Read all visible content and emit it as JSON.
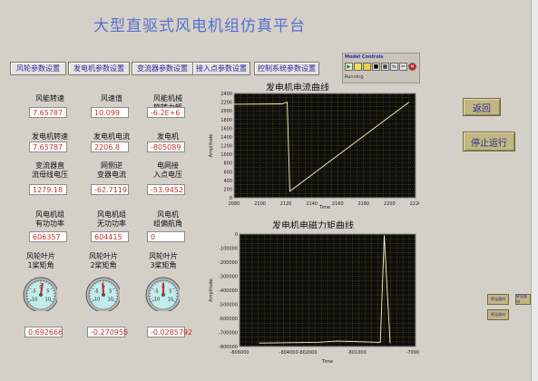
{
  "title": "大型直驱式风电机组仿真平台",
  "nav": [
    "风轮参数设置",
    "发电机参数设置",
    "变流器参数设置",
    "接入点参数设置",
    "控制系统参数设置"
  ],
  "fields": [
    {
      "label": "风能转速",
      "value": "7.65787"
    },
    {
      "label": "风速值",
      "value": "10.099"
    },
    {
      "label": "风能机械\n旋转力矩",
      "value": "-6.2E+6"
    },
    {
      "label": "发电机转速",
      "value": "7.65787"
    },
    {
      "label": "发电机电流",
      "value": "2206.8"
    },
    {
      "label": "发电机\n电磁力矩",
      "value": "-805089"
    },
    {
      "label": "变流器直\n流母线电压",
      "value": "1279.18"
    },
    {
      "label": "网侧逆\n变器电流",
      "value": "-62.7119"
    },
    {
      "label": "电网接\n入点电压",
      "value": "-53.9452"
    },
    {
      "label": "风电机组\n有功功率",
      "value": "606357"
    },
    {
      "label": "风电机组\n无功功率",
      "value": "604415"
    },
    {
      "label": "风电机\n组偏航角",
      "value": "0"
    }
  ],
  "blades": [
    {
      "label": "风轮叶片\n1桨矩角",
      "value": "0.692666",
      "gauge_value": 0.69
    },
    {
      "label": "风轮叶片\n2桨矩角",
      "value": "-0.270956",
      "gauge_value": -0.27
    },
    {
      "label": "风轮叶片\n3桨矩角",
      "value": "-0.0285792",
      "gauge_value": -0.03
    }
  ],
  "gauge_ticks": [
    "-5",
    "0",
    "5",
    "-10",
    "10"
  ],
  "model_controls": {
    "title": "Model Controls",
    "status": "Running"
  },
  "side_buttons": {
    "back": "返回",
    "stop": "停止运行"
  },
  "small_buttons": [
    "辉宝器材",
    "辉宝器材",
    "辉宝器材"
  ],
  "colors": {
    "plot_bg": "#0e0e0e",
    "grid": "#c8d000",
    "trace": "#fff6c0",
    "value_text": "#c0332c",
    "button_text": "#2a2aa0"
  },
  "chart_data": [
    {
      "type": "line",
      "title": "发电机电流曲线",
      "xlabel": "Time",
      "ylabel": "Amplitude",
      "xticks": [
        "2080",
        "2100",
        "2120",
        "2140",
        "2160",
        "2180",
        "2200",
        "2220"
      ],
      "yticks": [
        "2400",
        "2200",
        "2000",
        "1800",
        "1600",
        "1400",
        "1200",
        "1000",
        "800",
        "600",
        "400",
        "200",
        "0"
      ],
      "xlim": [
        2080,
        2220
      ],
      "ylim": [
        0,
        2400
      ],
      "series": [
        {
          "x": [
            2080,
            2117,
            2121,
            2123,
            2215
          ],
          "y": [
            2150,
            2160,
            2200,
            150,
            2200
          ]
        }
      ]
    },
    {
      "type": "line",
      "title": "发电机电磁力矩曲线",
      "xlabel": "Time",
      "ylabel": "Amplitude",
      "xticks": [
        "-806000",
        "-804000-802000",
        "-801000",
        "-799000"
      ],
      "yticks": [
        "0",
        "-100000",
        "-200000",
        "-300000",
        "-400000",
        "-500000",
        "-600000",
        "-700000",
        "-800000"
      ],
      "xlim": [
        -807000,
        -798000
      ],
      "ylim": [
        -820000,
        0
      ],
      "series": [
        {
          "x": [
            -806000,
            -803000,
            -802000,
            -799800,
            -799600,
            -799300
          ],
          "y": [
            -795000,
            -790000,
            -780000,
            -790000,
            -10000,
            -795000
          ]
        }
      ]
    }
  ]
}
